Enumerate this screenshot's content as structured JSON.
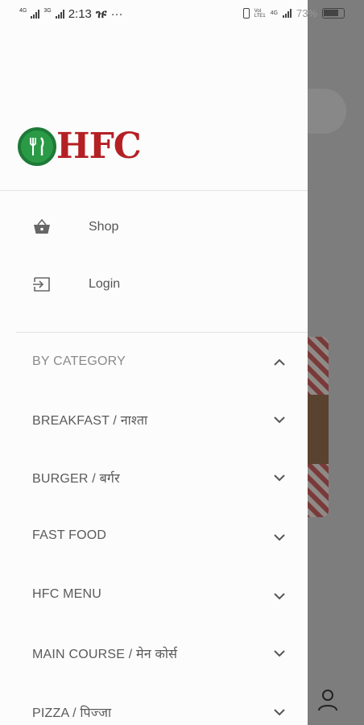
{
  "status_bar": {
    "net1": "4G",
    "net2": "3G",
    "time": "2:13",
    "carrier_glyph": "ዡ",
    "more": "···",
    "volte": "Vol\nLTE1",
    "net3": "4G",
    "battery_pct": "73%"
  },
  "brand": {
    "name": "HFC",
    "accent": "#b52025",
    "green": "#2b9a46"
  },
  "nav": [
    {
      "label": "Shop",
      "icon": "shopping-basket-icon"
    },
    {
      "label": "Login",
      "icon": "login-icon"
    }
  ],
  "category": {
    "header": "BY CATEGORY",
    "items": [
      "BREAKFAST / नाश्ता",
      "BURGER / बर्गर",
      "FAST FOOD",
      "HFC MENU",
      "MAIN COURSE / मेन कोर्स",
      "PIZZA / पिज्जा"
    ]
  }
}
